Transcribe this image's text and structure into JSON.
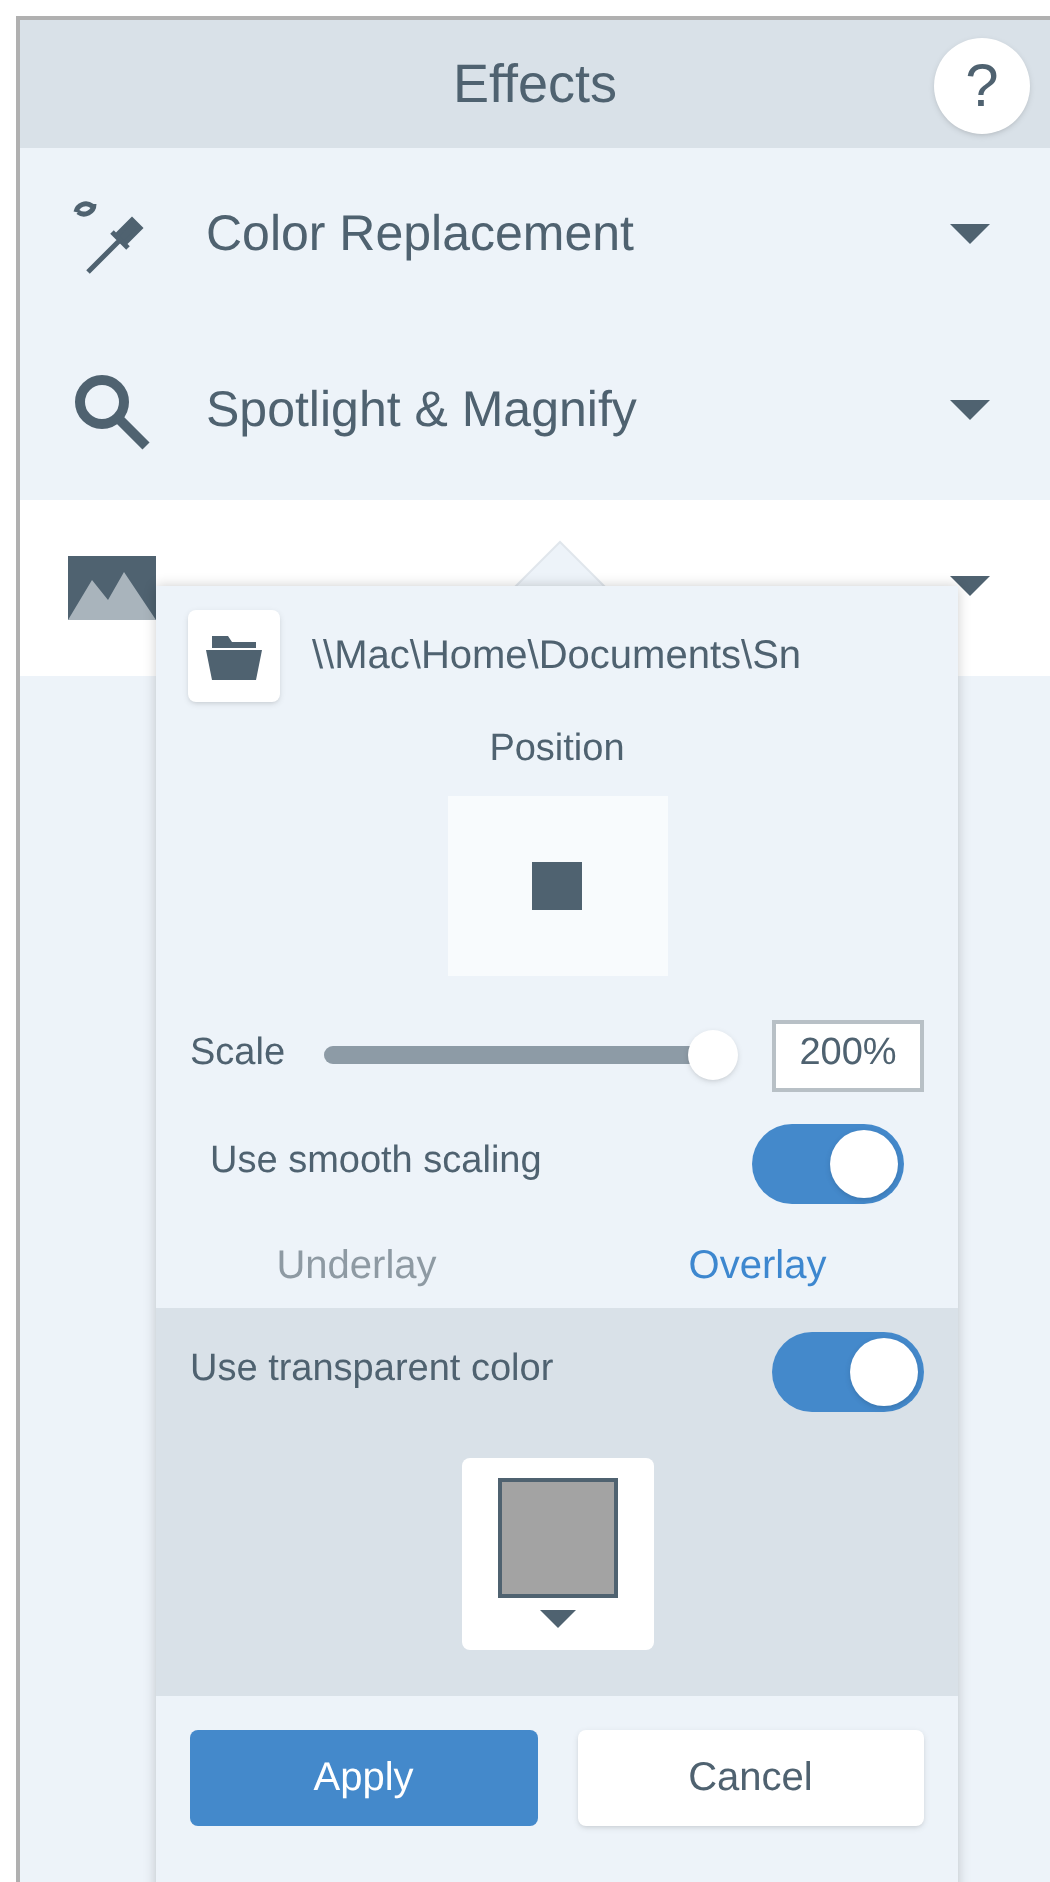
{
  "header": {
    "title": "Effects",
    "help": "?"
  },
  "effects": [
    {
      "kind": "color",
      "label": "Color Replacement",
      "expanded": false
    },
    {
      "kind": "spotlight",
      "label": "Spotlight & Magnify",
      "expanded": false
    },
    {
      "kind": "watermark",
      "expanded": true
    }
  ],
  "popover": {
    "path": "\\\\Mac\\Home\\Documents\\Sn",
    "position_label": "Position",
    "scale": {
      "label": "Scale",
      "level": 1,
      "value": "200%"
    },
    "smooth_scaling": {
      "label": "Use smooth scaling",
      "on": true
    },
    "tabs": [
      {
        "label": "Underlay",
        "selected": false
      },
      {
        "label": "Overlay",
        "selected": true
      }
    ],
    "transparent": {
      "label": "Use transparent color",
      "on": true,
      "color": "#a3a3a3"
    },
    "buttons": [
      {
        "label": "Apply",
        "kind": "primary"
      },
      {
        "label": "Cancel",
        "kind": "secondary"
      }
    ]
  }
}
